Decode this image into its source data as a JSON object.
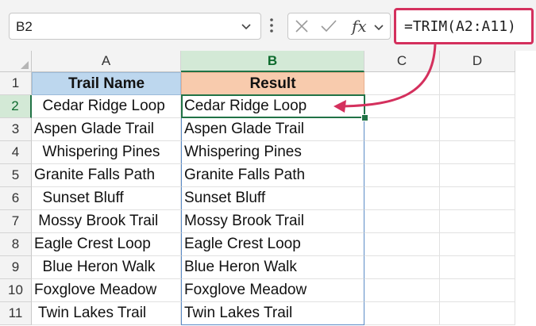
{
  "namebox": {
    "ref": "B2"
  },
  "formula": {
    "text": "=TRIM(A2:A11)",
    "fx_label": "fx"
  },
  "columns": [
    "A",
    "B",
    "C",
    "D"
  ],
  "rows": [
    "1",
    "2",
    "3",
    "4",
    "5",
    "6",
    "7",
    "8",
    "9",
    "10",
    "11"
  ],
  "headers": {
    "a": "Trail Name",
    "b": "Result"
  },
  "col_a": [
    "  Cedar Ridge Loop",
    "Aspen Glade Trail",
    "  Whispering Pines",
    "Granite Falls Path",
    "  Sunset Bluff",
    " Mossy Brook Trail",
    "Eagle Crest Loop",
    "  Blue Heron Walk",
    "Foxglove Meadow",
    " Twin Lakes Trail"
  ],
  "col_b": [
    "Cedar Ridge Loop",
    "Aspen Glade Trail",
    "Whispering Pines",
    "Granite Falls Path",
    "Sunset Bluff",
    "Mossy Brook Trail",
    "Eagle Crest Loop",
    "Blue Heron Walk",
    "Foxglove Meadow",
    "Twin Lakes Trail"
  ],
  "colors": {
    "highlight": "#d4305d",
    "selection": "#217346",
    "header_a_fill": "#bdd7ee",
    "header_b_fill": "#f8cbad"
  },
  "icons": [
    "chevron-down-icon",
    "more-options-icon",
    "cancel-icon",
    "enter-icon",
    "insert-function-icon"
  ]
}
